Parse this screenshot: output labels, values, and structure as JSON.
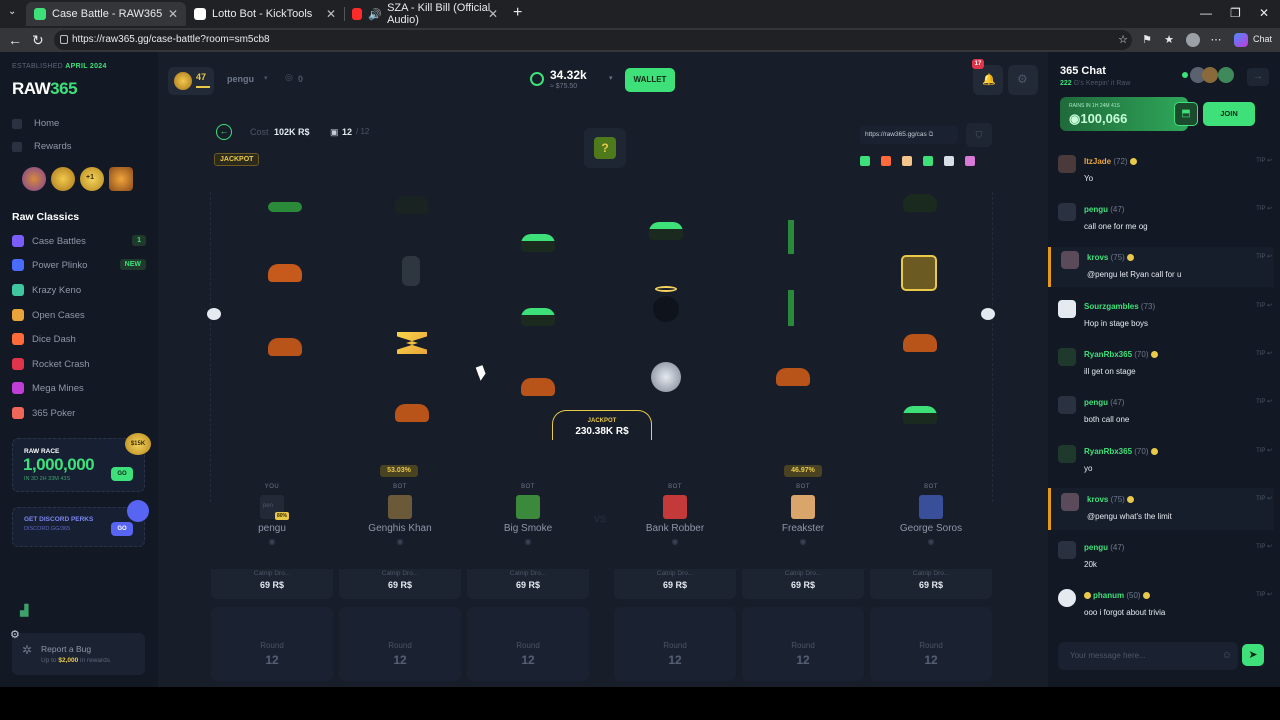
{
  "browser": {
    "tabs": [
      {
        "title": "Case Battle - RAW365",
        "color": "#3ee07a"
      },
      {
        "title": "Lotto Bot - KickTools",
        "color": "#ffffff"
      },
      {
        "title": "SZA - Kill Bill (Official Audio)",
        "color": "#ff2a2a"
      }
    ],
    "url": "https://raw365.gg/case-battle?room=sm5cb8",
    "chat_button": "Chat"
  },
  "sidebar": {
    "established_prefix": "ESTABLISHED",
    "established_date": "APRIL 2024",
    "logo_raw": "RAW",
    "logo_num": "365",
    "home": "Home",
    "rewards": "Rewards",
    "reward_badge": "+1",
    "section_title": "Raw Classics",
    "games": [
      {
        "label": "Case Battles",
        "badge": "1",
        "color": "#7a5cff"
      },
      {
        "label": "Power Plinko",
        "badge": "NEW",
        "color": "#4a6bff"
      },
      {
        "label": "Krazy Keno",
        "badge": "",
        "color": "#3ec7a0"
      },
      {
        "label": "Open Cases",
        "badge": "",
        "color": "#e9a43a"
      },
      {
        "label": "Dice Dash",
        "badge": "",
        "color": "#ff6a3a"
      },
      {
        "label": "Rocket Crash",
        "badge": "",
        "color": "#e0344a"
      },
      {
        "label": "Mega Mines",
        "badge": "",
        "color": "#c03ed8"
      },
      {
        "label": "365 Poker",
        "badge": "",
        "color": "#f0675a"
      }
    ],
    "race": {
      "title": "RAW RACE",
      "amount": "1,000,000",
      "sub": "IN 3D 2H 33M 43S",
      "button": "GO",
      "badge": "$15K"
    },
    "discord": {
      "title": "GET DISCORD PERKS",
      "link": "DISCORD.GG/365",
      "button": "GO"
    },
    "bug": {
      "title": "Report a Bug",
      "prefix": "Up to ",
      "amount": "$2,000",
      "suffix": " in rewards"
    }
  },
  "header": {
    "level": "47",
    "username": "pengu",
    "zero": "0",
    "balance": "34.32k",
    "balance_usd": "≈ $75.50",
    "wallet": "WALLET",
    "notif_count": "17"
  },
  "battle": {
    "cost_label": "Cost",
    "cost_value": "102K R$",
    "round": "12",
    "round_total": "/ 12",
    "mode_badge": "JACKPOT",
    "share_url": "https://raw365.gg/cas",
    "jackpot_label": "JACKPOT",
    "jackpot_value": "230.38K R$",
    "players": [
      {
        "role": "YOU",
        "name": "pengu",
        "pct": "",
        "av": "#2a3242"
      },
      {
        "role": "BOT",
        "name": "Genghis Khan",
        "pct": "53.03%",
        "av": "#6b5a3a"
      },
      {
        "role": "BOT",
        "name": "Big Smoke",
        "pct": "",
        "av": "#3b8a3b"
      },
      {
        "role": "BOT",
        "name": "Bank Robber",
        "pct": "",
        "av": "#c43a3a"
      },
      {
        "role": "BOT",
        "name": "Freakster",
        "pct": "46.97%",
        "av": "#d9a56b"
      },
      {
        "role": "BOT",
        "name": "George Soros",
        "pct": "",
        "av": "#3a4f9a"
      }
    ],
    "my_badge": "80%",
    "my_placeholder": "pen",
    "case_label": "Catnip Dro...",
    "case_value": "69 R$",
    "round_label": "Round",
    "round_value": "12"
  },
  "chat": {
    "title": "365 Chat",
    "online": "222",
    "online_suffix": " G's Keepin' it Raw",
    "rain_label": "RAINS IN 1H 24M 41S",
    "rain_amount": "100,066",
    "join": "JOIN",
    "tip": "TIP",
    "placeholder": "Your message here...",
    "messages": [
      {
        "user": "ItzJade",
        "level": "(72)",
        "text": "Yo",
        "hl": false
      },
      {
        "user": "pengu",
        "level": "(47)",
        "text": "call one for me og",
        "hl": false
      },
      {
        "user": "krovs",
        "level": "(75)",
        "text": "@pengu let Ryan call for u",
        "hl": true
      },
      {
        "user": "Sourzgambles",
        "level": "(73)",
        "text": "Hop in stage boys",
        "hl": false
      },
      {
        "user": "RyanRbx365",
        "level": "(70)",
        "text": "ill get on stage",
        "hl": false
      },
      {
        "user": "pengu",
        "level": "(47)",
        "text": "both call one",
        "hl": false
      },
      {
        "user": "RyanRbx365",
        "level": "(70)",
        "text": "yo",
        "hl": false
      },
      {
        "user": "krovs",
        "level": "(75)",
        "text": "@pengu what's the limit",
        "hl": true
      },
      {
        "user": "pengu",
        "level": "(47)",
        "text": "20k",
        "hl": false
      },
      {
        "user": "phanum",
        "level": "(50)",
        "text": "ooo i forgot about trivia",
        "hl": false
      }
    ]
  }
}
